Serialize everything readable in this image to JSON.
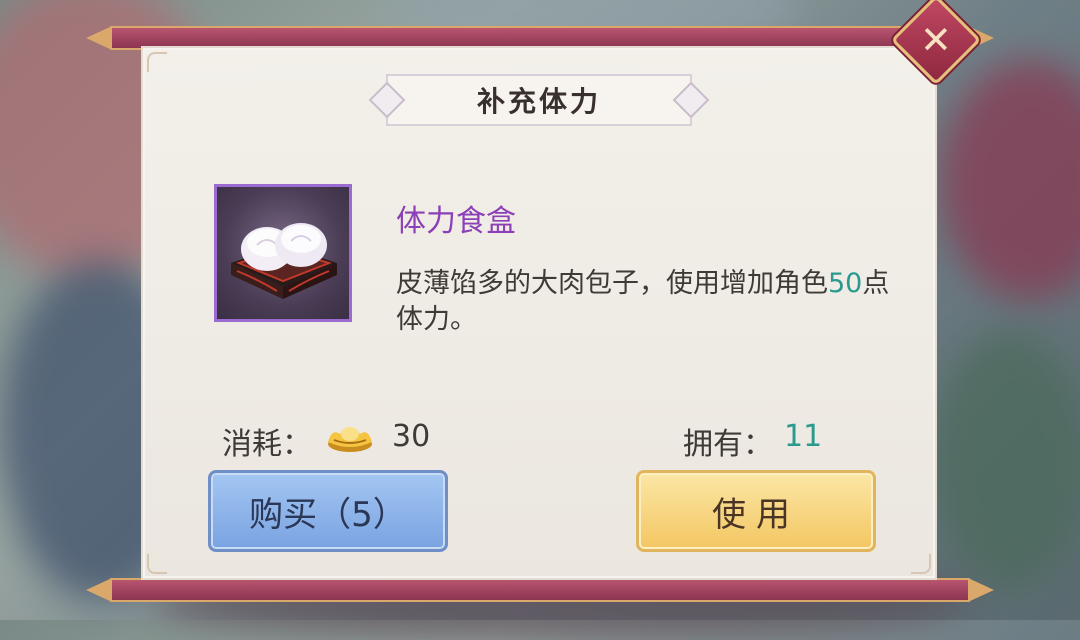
{
  "dialog": {
    "title": "补充体力",
    "close_icon": "close-icon"
  },
  "item": {
    "icon": "steamed-buns-icon",
    "name": "体力食盒",
    "description_prefix": "皮薄馅多的大肉包子，使用增加角色",
    "description_amount": "50",
    "description_suffix": "点体力。"
  },
  "cost": {
    "label": "消耗：",
    "currency_icon": "gold-ingot-icon",
    "value": "30"
  },
  "owned": {
    "label": "拥有：",
    "value": "11"
  },
  "buttons": {
    "buy_label": "购买（5）",
    "use_label": "使用"
  },
  "colors": {
    "item_name": "#8c3fb6",
    "highlight": "#2b9a8e",
    "buy_button": "#8fb4ea",
    "use_button": "#f6d27e",
    "close_button": "#a83552"
  }
}
